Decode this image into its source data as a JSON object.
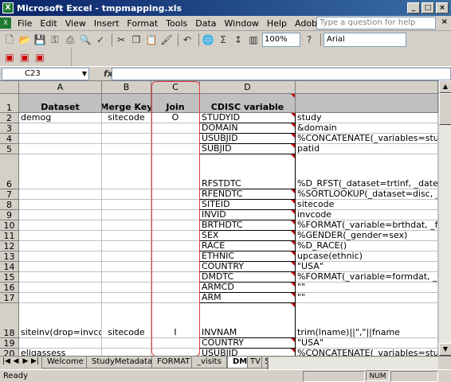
{
  "window": {
    "title": "Microsoft Excel - tmpmapping.xls"
  },
  "menu": {
    "items": [
      "File",
      "Edit",
      "View",
      "Insert",
      "Format",
      "Tools",
      "Data",
      "Window",
      "Help",
      "Adobe PDF"
    ],
    "help_placeholder": "Type a question for help"
  },
  "toolbar": {
    "zoom": "100%",
    "font": "Arial"
  },
  "formula": {
    "name_box": "C23",
    "fx": "fx",
    "value": ""
  },
  "columns": [
    "A",
    "B",
    "C",
    "D"
  ],
  "rows": [
    {
      "num": "1",
      "a": "Dataset",
      "b": "Merge Key",
      "c": "Join",
      "d": "CDISC variable",
      "e": "",
      "header": true
    },
    {
      "num": "2",
      "a": "demog",
      "b": "sitecode",
      "c": "O",
      "d": "STUDYID",
      "e": "study"
    },
    {
      "num": "3",
      "a": "",
      "b": "",
      "c": "",
      "d": "DOMAIN",
      "e": "&domain"
    },
    {
      "num": "4",
      "a": "",
      "b": "",
      "c": "",
      "d": "USUBJID",
      "e": "%CONCATENATE(_variables=study s"
    },
    {
      "num": "5",
      "a": "",
      "b": "",
      "c": "",
      "d": "SUBJID",
      "e": "patid"
    },
    {
      "num": "6",
      "a": "",
      "b": "",
      "c": "",
      "d": "RFSTDTC",
      "e": "%D_RFST(_dataset=trtinf, _date=trtin"
    },
    {
      "num": "7",
      "a": "",
      "b": "",
      "c": "",
      "d": "RFENDTC",
      "e": "%SORTLOOKUP(_dataset=disc, _var"
    },
    {
      "num": "8",
      "a": "",
      "b": "",
      "c": "",
      "d": "SITEID",
      "e": "sitecode"
    },
    {
      "num": "9",
      "a": "",
      "b": "",
      "c": "",
      "d": "INVID",
      "e": "invcode"
    },
    {
      "num": "10",
      "a": "",
      "b": "",
      "c": "",
      "d": "BRTHDTC",
      "e": "%FORMAT(_variable=brthdat, _format"
    },
    {
      "num": "11",
      "a": "",
      "b": "",
      "c": "",
      "d": "SEX",
      "e": "%GENDER(_gender=sex)"
    },
    {
      "num": "12",
      "a": "",
      "b": "",
      "c": "",
      "d": "RACE",
      "e": "%D_RACE()"
    },
    {
      "num": "13",
      "a": "",
      "b": "",
      "c": "",
      "d": "ETHNIC",
      "e": "upcase(ethnic)"
    },
    {
      "num": "14",
      "a": "",
      "b": "",
      "c": "",
      "d": "COUNTRY",
      "e": "\"USA\""
    },
    {
      "num": "15",
      "a": "",
      "b": "",
      "c": "",
      "d": "DMDTC",
      "e": "%FORMAT(_variable=formdat, _format"
    },
    {
      "num": "16",
      "a": "",
      "b": "",
      "c": "",
      "d": "ARMCD",
      "e": "\"\""
    },
    {
      "num": "17",
      "a": "",
      "b": "",
      "c": "",
      "d": "ARM",
      "e": "\"\""
    },
    {
      "num": "18",
      "a": "siteinv(drop=invcode)",
      "b": "sitecode",
      "c": "I",
      "d": "INVNAM",
      "e": "trim(lname)||\",\"||fname"
    },
    {
      "num": "19",
      "a": "",
      "b": "",
      "c": "",
      "d": "COUNTRY",
      "e": "\"USA\""
    },
    {
      "num": "20",
      "a": "eligassess",
      "b": "",
      "c": "",
      "d": "USUBJID",
      "e": "%CONCATENATE(_variables=study s"
    }
  ],
  "sheet_tabs": [
    "Welcome",
    "StudyMetadata",
    "FORMAT",
    "_visits",
    "DM",
    "TV",
    "5"
  ],
  "active_tab": "DM",
  "status": {
    "text": "Ready",
    "num": "NUM"
  }
}
